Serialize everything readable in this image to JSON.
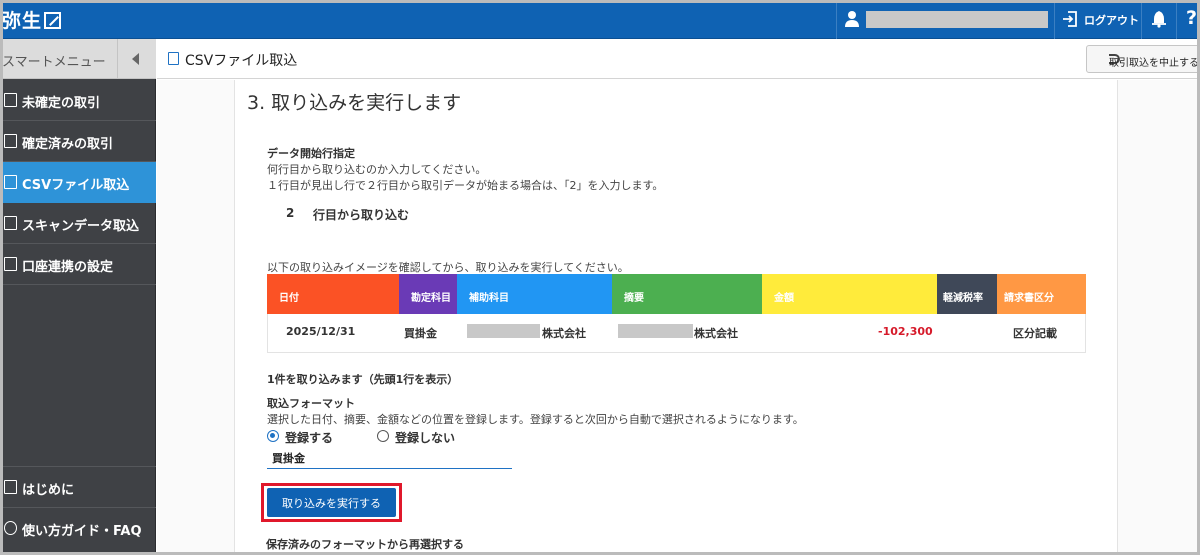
{
  "header": {
    "logo": "弥生",
    "logout": "ログアウト",
    "help": "?"
  },
  "sidebar": {
    "title": "スマートメニュー",
    "items": [
      {
        "label": "未確定の取引",
        "icon": "list-icon"
      },
      {
        "label": "確定済みの取引",
        "icon": "checklist-icon"
      },
      {
        "label": "CSVファイル取込",
        "icon": "file-upload-icon"
      },
      {
        "label": "スキャンデータ取込",
        "icon": "scanner-icon"
      },
      {
        "label": "口座連携の設定",
        "icon": "bank-icon"
      }
    ],
    "bottom_items": [
      {
        "label": "はじめに",
        "icon": "book-icon"
      },
      {
        "label": "使い方ガイド・FAQ",
        "icon": "question-icon"
      }
    ]
  },
  "page": {
    "title": "CSVファイル取込",
    "cancel_button": "取引取込を中止する"
  },
  "step": {
    "title": "3. 取り込みを実行します",
    "start_row": {
      "title": "データ開始行指定",
      "desc1": "何行目から取り込むのか入力してください。",
      "desc2": "１行目が見出し行で２行目から取引データが始まる場合は、「2」を入力します。",
      "value": "2",
      "suffix": "行目から取り込む"
    },
    "preview": {
      "note": "以下の取り込みイメージを確認してから、取り込みを実行してください。",
      "columns": [
        {
          "label": "日付",
          "color": "#fb5225"
        },
        {
          "label": "勘定科目",
          "color": "#6a3ab6"
        },
        {
          "label": "補助科目",
          "color": "#2196f3"
        },
        {
          "label": "摘要",
          "color": "#4caf50"
        },
        {
          "label": "金額",
          "color": "#ffeb3b"
        },
        {
          "label": "軽減税率",
          "color": "#3f4858"
        },
        {
          "label": "請求書区分",
          "color": "#ff9844"
        }
      ],
      "row": {
        "date": "2025/12/31",
        "account": "買掛金",
        "sub_account": "株式会社",
        "description": "株式会社",
        "amount": "-102,300",
        "reduced_tax": "",
        "invoice_type": "区分記載"
      }
    },
    "count_note": "1件を取り込みます（先頭1行を表示）",
    "format": {
      "title": "取込フォーマット",
      "desc": "選択した日付、摘要、金額などの位置を登録します。登録すると次回から自動で選択されるようになります。",
      "register": "登録する",
      "no_register": "登録しない",
      "selected": "register",
      "name": "買掛金"
    },
    "execute_button": "取り込みを実行する",
    "reselect": "保存済みのフォーマットから再選択する"
  }
}
